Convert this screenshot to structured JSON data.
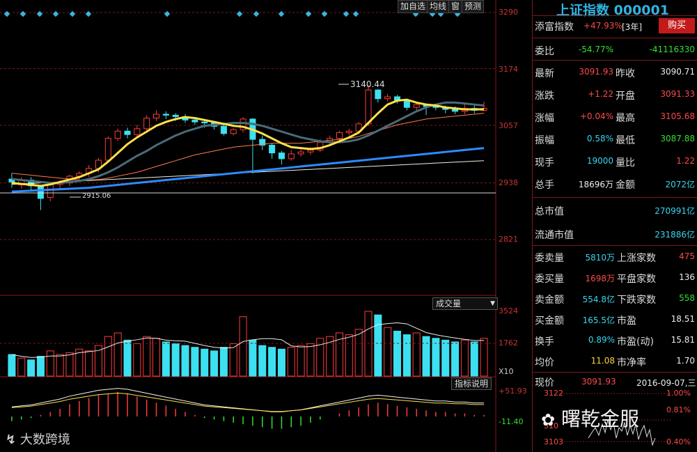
{
  "toolbar": {
    "add_fav": "加自选",
    "ma_lines": "均线",
    "window": "窗",
    "forecast": "预测"
  },
  "price_axis": [
    "3290",
    "3174",
    "3057",
    "2938",
    "2821"
  ],
  "volume_axis": [
    "3524",
    "1762",
    "X10"
  ],
  "macd_axis": [
    "+51.93",
    "-11.40"
  ],
  "annotations": {
    "high_mark": "3140.44",
    "low_mark": "2915.06"
  },
  "volume_dropdown": "成交量",
  "indicator_help": "指标说明",
  "stock": {
    "name": "上证指数",
    "code": "000001"
  },
  "tianfu": {
    "label": "添富指数",
    "value": "+47.93%",
    "period": "[3年]",
    "buy": "购买"
  },
  "weibi": {
    "label": "委比",
    "pct": "-54.77%",
    "diff": "-41116330"
  },
  "quote": {
    "latest_l": "最新",
    "latest": "3091.93",
    "prev_close_l": "昨收",
    "prev_close": "3090.71",
    "change_l": "涨跌",
    "change": "+1.22",
    "open_l": "开盘",
    "open": "3091.33",
    "change_pct_l": "涨幅",
    "change_pct": "+0.04%",
    "high_l": "最高",
    "high": "3105.68",
    "amplitude_l": "振幅",
    "amplitude": "0.58%",
    "low_l": "最低",
    "low": "3087.88",
    "cur_vol_l": "现手",
    "cur_vol": "19000",
    "vol_ratio_l": "量比",
    "vol_ratio": "1.22",
    "total_vol_l": "总手",
    "total_vol": "18696万",
    "amount_l": "金额",
    "amount": "2072亿"
  },
  "market_cap": {
    "total_l": "总市值",
    "total": "270991亿",
    "float_l": "流通市值",
    "float": "231886亿"
  },
  "orders": {
    "sell_vol_l": "委卖量",
    "sell_vol": "5810万",
    "up_count_l": "上涨家数",
    "up_count": "475",
    "buy_vol_l": "委买量",
    "buy_vol": "1698万",
    "flat_count_l": "平盘家数",
    "flat_count": "136",
    "sell_amt_l": "卖金额",
    "sell_amt": "554.8亿",
    "down_count_l": "下跌家数",
    "down_count": "558",
    "buy_amt_l": "买金额",
    "buy_amt": "165.5亿",
    "pe_l": "市盈",
    "pe": "18.51",
    "turnover_l": "换手",
    "turnover": "0.89%",
    "pe_dyn_l": "市盈(动)",
    "pe_dyn": "15.81",
    "avg_l": "均价",
    "avg": "11.08",
    "pb_l": "市净率",
    "pb": "1.70"
  },
  "bottom": {
    "now_l": "现价",
    "now": "3091.93",
    "date": "2016-09-07,三"
  },
  "mini": {
    "top_price": "3122",
    "bot_price": "3103",
    "top_pct": "1.00%",
    "mid_pct": "0.81%",
    "bot_pct": "0.40%",
    "mid_price": "310"
  },
  "watermarks": {
    "left": "大数跨境",
    "right": "曙乾金服"
  },
  "chart_data": {
    "type": "candlestick",
    "price_range": [
      2780,
      3290
    ],
    "candles": [
      [
        2946,
        2940,
        2958,
        2928
      ],
      [
        2934,
        2944,
        2950,
        2926
      ],
      [
        2944,
        2932,
        2950,
        2920
      ],
      [
        2932,
        2906,
        2934,
        2882
      ],
      [
        2908,
        2935,
        2940,
        2900
      ],
      [
        2935,
        2938,
        2944,
        2925
      ],
      [
        2938,
        2952,
        2955,
        2932
      ],
      [
        2952,
        2958,
        2962,
        2945
      ],
      [
        2958,
        2968,
        2975,
        2950
      ],
      [
        2968,
        2985,
        2990,
        2960
      ],
      [
        2985,
        3030,
        3034,
        2982
      ],
      [
        3030,
        3045,
        3050,
        3025
      ],
      [
        3045,
        3038,
        3052,
        3030
      ],
      [
        3038,
        3050,
        3058,
        3034
      ],
      [
        3050,
        3072,
        3078,
        3046
      ],
      [
        3072,
        3080,
        3088,
        3066
      ],
      [
        3080,
        3078,
        3086,
        3070
      ],
      [
        3078,
        3075,
        3082,
        3066
      ],
      [
        3075,
        3068,
        3080,
        3062
      ],
      [
        3068,
        3064,
        3072,
        3058
      ],
      [
        3064,
        3062,
        3070,
        3052
      ],
      [
        3062,
        3055,
        3066,
        3048
      ],
      [
        3055,
        3040,
        3058,
        3036
      ],
      [
        3040,
        3048,
        3052,
        3036
      ],
      [
        3048,
        3070,
        3074,
        3042
      ],
      [
        3070,
        3028,
        3072,
        2958
      ],
      [
        3028,
        3016,
        3036,
        3006
      ],
      [
        3016,
        3000,
        3020,
        2988
      ],
      [
        3000,
        2988,
        3004,
        2976
      ],
      [
        2988,
        2998,
        3006,
        2984
      ],
      [
        2998,
        3002,
        3008,
        2992
      ],
      [
        3002,
        3006,
        3012,
        2996
      ],
      [
        3006,
        3022,
        3028,
        3002
      ],
      [
        3022,
        3030,
        3036,
        3016
      ],
      [
        3030,
        3042,
        3046,
        3024
      ],
      [
        3042,
        3045,
        3050,
        3036
      ],
      [
        3045,
        3060,
        3064,
        3040
      ],
      [
        3060,
        3130,
        3140,
        3056
      ],
      [
        3130,
        3112,
        3132,
        3104
      ],
      [
        3112,
        3116,
        3122,
        3106
      ],
      [
        3116,
        3108,
        3120,
        3102
      ],
      [
        3108,
        3094,
        3110,
        3088
      ],
      [
        3094,
        3100,
        3106,
        3088
      ],
      [
        3100,
        3096,
        3102,
        3078
      ],
      [
        3096,
        3094,
        3102,
        3088
      ],
      [
        3094,
        3090,
        3098,
        3082
      ],
      [
        3090,
        3086,
        3096,
        3080
      ],
      [
        3086,
        3092,
        3100,
        3080
      ],
      [
        3092,
        3088,
        3098,
        3082
      ],
      [
        3088,
        3092,
        3106,
        3086
      ]
    ],
    "volume": [
      12,
      10,
      9,
      11,
      14,
      12,
      13,
      15,
      14,
      17,
      22,
      24,
      20,
      18,
      22,
      21,
      19,
      18,
      17,
      16,
      15,
      14,
      16,
      18,
      33,
      20,
      17,
      16,
      15,
      16,
      17,
      18,
      21,
      22,
      24,
      23,
      26,
      36,
      34,
      27,
      25,
      23,
      24,
      22,
      21,
      20,
      19,
      20,
      19,
      21
    ],
    "macd_hist": [
      -3,
      -2,
      -1,
      1,
      3,
      5,
      8,
      10,
      12,
      14,
      15,
      16,
      15,
      13,
      11,
      9,
      7,
      5,
      3,
      1,
      -1,
      -2,
      -3,
      -4,
      -5,
      -6,
      -7,
      -8,
      -8,
      -7,
      -6,
      -4,
      -2,
      0,
      2,
      4,
      6,
      8,
      9,
      8,
      7,
      6,
      5,
      4,
      3,
      3,
      2,
      2,
      1,
      1
    ],
    "ma5": [
      2938,
      2936,
      2934,
      2932,
      2935,
      2940,
      2945,
      2950,
      2958,
      2966,
      2982,
      3000,
      3018,
      3032,
      3044,
      3056,
      3064,
      3070,
      3074,
      3072,
      3068,
      3064,
      3060,
      3056,
      3054,
      3048,
      3040,
      3030,
      3020,
      3012,
      3010,
      3008,
      3010,
      3016,
      3024,
      3032,
      3042,
      3062,
      3082,
      3100,
      3108,
      3110,
      3104,
      3100,
      3098,
      3094,
      3092,
      3090,
      3090,
      3090
    ],
    "ma10": [
      2946,
      2944,
      2942,
      2940,
      2938,
      2938,
      2940,
      2942,
      2946,
      2952,
      2960,
      2970,
      2982,
      2994,
      3004,
      3016,
      3026,
      3036,
      3044,
      3050,
      3056,
      3058,
      3060,
      3062,
      3062,
      3060,
      3056,
      3050,
      3044,
      3038,
      3032,
      3028,
      3024,
      3022,
      3022,
      3024,
      3028,
      3036,
      3046,
      3056,
      3066,
      3076,
      3086,
      3094,
      3100,
      3104,
      3104,
      3102,
      3100,
      3098
    ],
    "ma20": [
      2958,
      2956,
      2954,
      2952,
      2950,
      2948,
      2946,
      2944,
      2944,
      2945,
      2948,
      2952,
      2956,
      2960,
      2966,
      2972,
      2978,
      2984,
      2990,
      2996,
      3000,
      3004,
      3008,
      3012,
      3014,
      3016,
      3018,
      3020,
      3020,
      3020,
      3020,
      3022,
      3024,
      3026,
      3028,
      3030,
      3034,
      3040,
      3046,
      3052,
      3058,
      3062,
      3066,
      3070,
      3072,
      3074,
      3076,
      3078,
      3080,
      3082
    ],
    "ma60": [
      2920,
      2921,
      2922,
      2923,
      2924,
      2925,
      2926,
      2927,
      2928,
      2930,
      2932,
      2934,
      2936,
      2938,
      2940,
      2942,
      2944,
      2946,
      2948,
      2950,
      2952,
      2954,
      2956,
      2958,
      2960,
      2962,
      2964,
      2966,
      2968,
      2970,
      2972,
      2974,
      2976,
      2978,
      2980,
      2982,
      2984,
      2986,
      2988,
      2990,
      2992,
      2994,
      2996,
      2998,
      3000,
      3002,
      3004,
      3006,
      3008,
      3010
    ],
    "ma250": [
      2935,
      2936,
      2937,
      2938,
      2939,
      2940,
      2941,
      2942,
      2943,
      2944,
      2945,
      2946,
      2947,
      2948,
      2949,
      2950,
      2951,
      2952,
      2953,
      2954,
      2955,
      2956,
      2957,
      2958,
      2959,
      2960,
      2961,
      2962,
      2963,
      2964,
      2965,
      2966,
      2967,
      2968,
      2969,
      2970,
      2971,
      2972,
      2973,
      2974,
      2975,
      2976,
      2977,
      2978,
      2979,
      2980,
      2981,
      2982,
      2983,
      2984
    ]
  }
}
